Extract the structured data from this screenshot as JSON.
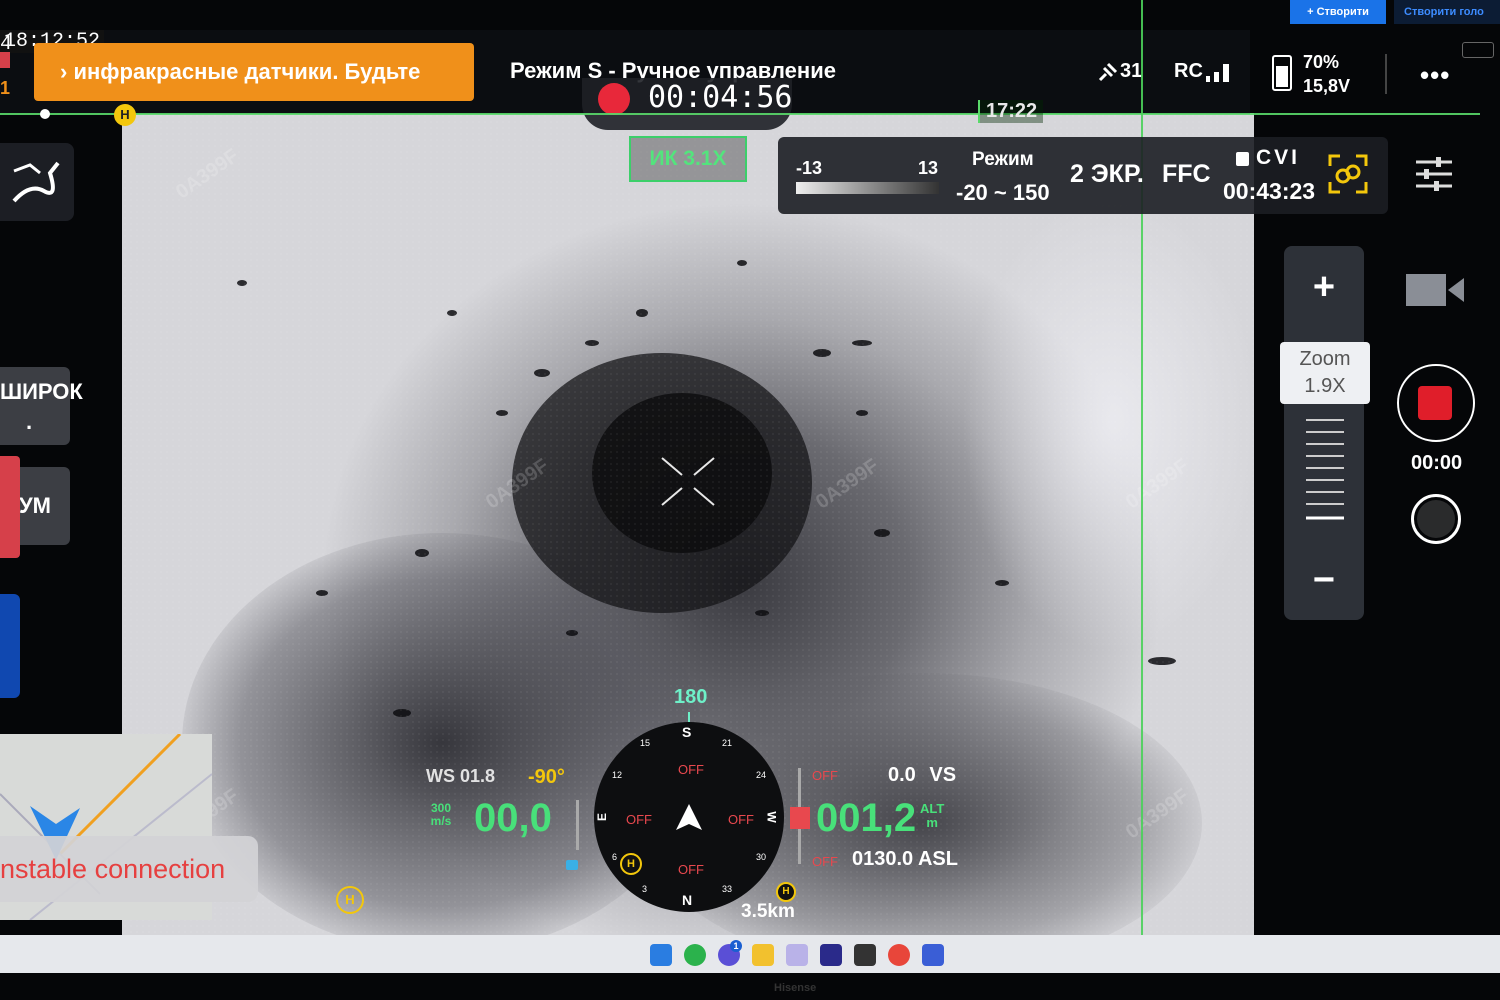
{
  "status": {
    "clock": "18:12:52",
    "left_digit_top": "4",
    "left_digit_mid": "1",
    "warning_banner": "› инфракрасные датчики. Будьте",
    "flight_mode": "Режим S - Ручное управление",
    "recording_time": "00:04:56",
    "satellites": "31",
    "rc_label": "RC",
    "battery_percent": "70%",
    "battery_voltage": "15,8V",
    "more_label": "•••",
    "flight_timer": "17:22",
    "home_badge": "H"
  },
  "windows_top": {
    "create_button": "+ Створити",
    "voice_button": "Створити голо"
  },
  "ir": {
    "zoom_badge": "ИК 3.1X",
    "scale_low": "-13",
    "scale_high": "13",
    "mode_label": "Режим",
    "range": "-20 ~ 150",
    "screen_label": "2 ЭКР.",
    "ffc_label": "FFC",
    "cvi_label": "CVI",
    "remaining_time": "00:43:23"
  },
  "left_panel": {
    "lens_wide": "ШИРОК",
    "lens_wide_sub": ".",
    "lens_zoom": "ЗУМ",
    "connection_status": "nstable connection"
  },
  "right_panel": {
    "zoom_plus": "+",
    "zoom_label": "Zoom",
    "zoom_value": "1.9X",
    "zoom_minus": "−",
    "record_time": "00:00"
  },
  "hud": {
    "heading": "180",
    "wind_speed": "WS 01.8",
    "gimbal_pitch": "-90°",
    "speed_unit_top": "300",
    "speed_unit_bottom": "m/s",
    "horizontal_speed": "00,0",
    "vertical_speed": "0.0",
    "vs_label": "VS",
    "altitude": "001,2",
    "alt_label": "ALT",
    "alt_unit": "m",
    "asl": "0130.0 ASL",
    "distance": "3.5km",
    "off_labels": [
      "OFF",
      "OFF",
      "OFF",
      "OFF",
      "OFF",
      "OFF"
    ],
    "compass_s": "S",
    "compass_n": "N",
    "compass_e": "E",
    "compass_w": "W",
    "compass_ticks": [
      "15",
      "21",
      "24",
      "30",
      "33",
      "3",
      "6",
      "12"
    ]
  },
  "overlay": {
    "watermark": "0A399F"
  },
  "taskbar": {
    "notification_count": "1",
    "brand": "Hisense",
    "icons": [
      "windows-icon",
      "whatsapp-icon",
      "chat-icon",
      "folder-icon",
      "snipping-icon",
      "app-icon",
      "game-icon",
      "chrome-icon",
      "app2-icon"
    ]
  }
}
